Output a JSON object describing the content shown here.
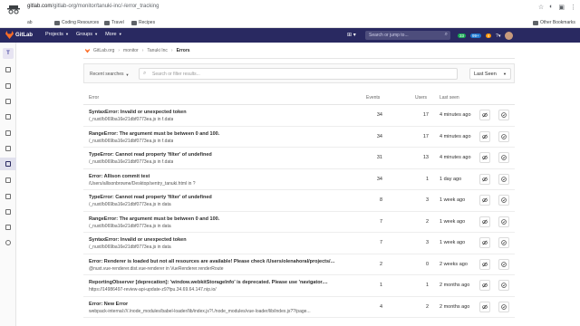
{
  "browser": {
    "url_host": "gitlab.com",
    "url_path": "/gitlab-org/monitor/tanuki-inc/-/error_tracking",
    "bookmarks": [
      "ab",
      "Coding Resources",
      "Travel",
      "Recipes"
    ],
    "other_bookmarks": "Other Bookmarks"
  },
  "header": {
    "logo_text": "GitLab",
    "nav": [
      "Projects",
      "Groups",
      "More"
    ],
    "search_placeholder": "Search or jump to...",
    "badges": [
      "33",
      "99+",
      "4"
    ]
  },
  "sidebar": {
    "project_letter": "T"
  },
  "breadcrumb": {
    "items": [
      "GitLab.org",
      "monitor",
      "Tanuki Inc"
    ],
    "current": "Errors"
  },
  "filter": {
    "recent_searches": "Recent searches",
    "placeholder": "Search or filter results...",
    "sort_label": "Last Seen"
  },
  "table": {
    "headers": {
      "error": "Error",
      "events": "Events",
      "users": "Users",
      "last_seen": "Last seen"
    },
    "rows": [
      {
        "title": "SyntaxError: Invalid or unexpected token",
        "sub": "/_nuxt/b069ba16e21dbf0773ea.js in f.data",
        "events": "34",
        "users": "17",
        "last_seen": "4 minutes ago"
      },
      {
        "title": "RangeError: The argument must be between 0 and 100.",
        "sub": "/_nuxt/b069ba16e21dbf0773ea.js in f.data",
        "events": "34",
        "users": "17",
        "last_seen": "4 minutes ago"
      },
      {
        "title": "TypeError: Cannot read property 'filter' of undefined",
        "sub": "/_nuxt/b069ba16e21dbf0773ea.js in f.data",
        "events": "31",
        "users": "13",
        "last_seen": "4 minutes ago"
      },
      {
        "title": "Error: Allison commit test",
        "sub": "/Users/allisonbrowne/Desktop/sentry_tanuki.html in ?",
        "events": "34",
        "users": "1",
        "last_seen": "1 day ago"
      },
      {
        "title": "TypeError: Cannot read property 'filter' of undefined",
        "sub": "/_nuxt/b069ba16e21dbf0773ea.js in data",
        "events": "8",
        "users": "3",
        "last_seen": "1 week ago"
      },
      {
        "title": "RangeError: The argument must be between 0 and 100.",
        "sub": "/_nuxt/b069ba16e21dbf0773ea.js in data",
        "events": "7",
        "users": "2",
        "last_seen": "1 week ago"
      },
      {
        "title": "SyntaxError: Invalid or unexpected token",
        "sub": "/_nuxt/b069ba16e21dbf0773ea.js in data",
        "events": "7",
        "users": "3",
        "last_seen": "1 week ago"
      },
      {
        "title": "Error: Renderer is loaded but not all resources are available! Please check /Users/olenahoral/projects/...",
        "sub": "@nuxt.vue-renderer.dist.vue-renderer in VueRenderer.renderRoute",
        "events": "2",
        "users": "0",
        "last_seen": "2 weeks ago"
      },
      {
        "title": "ReportingObserver [deprecation]: 'window.webkitStorageInfo' is deprecated. Please use 'navigator....",
        "sub": "https://14986497-review-api-update-z97fpu.34.69.64.147.nip.io/",
        "events": "1",
        "users": "1",
        "last_seen": "2 months ago"
      },
      {
        "title": "Error: New Error",
        "sub": "webpack-internal:///./node_modules/babel-loader/lib/index.js?!./node_modules/vue-loader/lib/index.js??/page...",
        "events": "4",
        "users": "2",
        "last_seen": "2 months ago"
      }
    ]
  }
}
